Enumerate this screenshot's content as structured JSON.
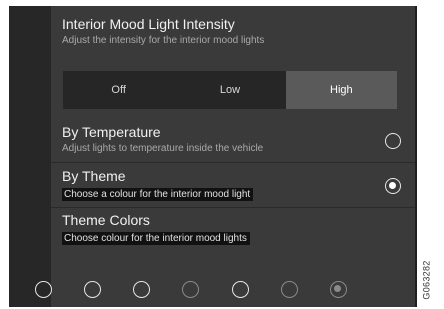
{
  "intensity": {
    "title": "Interior Mood Light Intensity",
    "subtitle": "Adjust the intensity for the interior mood lights",
    "options": [
      "Off",
      "Low",
      "High"
    ],
    "selected": "High"
  },
  "by_temperature": {
    "title": "By Temperature",
    "subtitle": "Adjust lights to temperature inside the vehicle",
    "checked": false
  },
  "by_theme": {
    "title": "By Theme",
    "subtitle": "Choose a colour for the interior mood light",
    "checked": true
  },
  "theme_colors": {
    "title": "Theme Colors",
    "subtitle": "Choose colour for the interior mood lights",
    "swatch_count": 7,
    "selected_index": 6
  },
  "image_id": "G063282"
}
